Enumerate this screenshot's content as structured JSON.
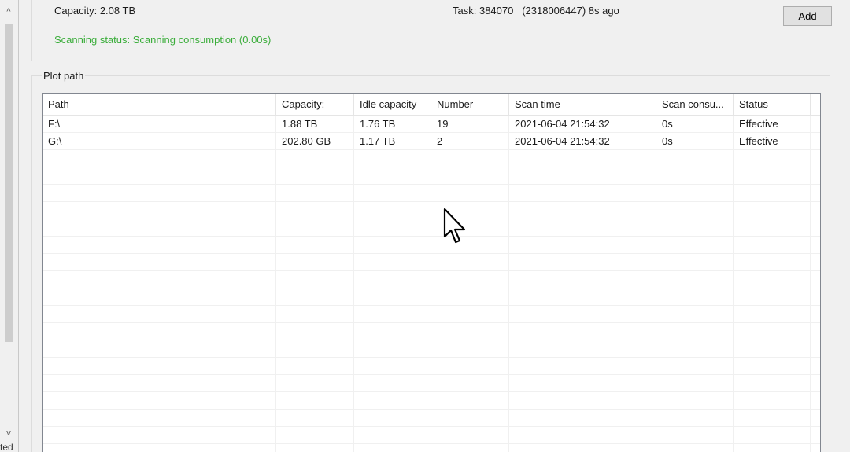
{
  "left_panel": {
    "scroll_up_glyph": "^",
    "scroll_down_glyph": "v",
    "clipped_text": "ted"
  },
  "info": {
    "capacity_label": "Capacity:",
    "capacity_value": "2.08 TB",
    "task_label": "Task:",
    "task_value": "384070",
    "task_detail": "(2318006447) 8s ago",
    "scan_status_label": "Scanning status:",
    "scan_status_value": "Scanning consumption (0.00s)"
  },
  "buttons": {
    "top_label": "",
    "add_label": "Add"
  },
  "plot_path": {
    "legend": "Plot path",
    "columns": [
      "Path",
      "Capacity:",
      "Idle capacity",
      "Number",
      "Scan time",
      "Scan consu...",
      "Status"
    ],
    "rows": [
      [
        "F:\\",
        "1.88 TB",
        "1.76 TB",
        "19",
        "2021-06-04 21:54:32",
        "0s",
        "Effective"
      ],
      [
        "G:\\",
        "202.80 GB",
        "1.17 TB",
        "2",
        "2021-06-04 21:54:32",
        "0s",
        "Effective"
      ],
      [
        "",
        "",
        "",
        "",
        "",
        "",
        ""
      ],
      [
        "",
        "",
        "",
        "",
        "",
        "",
        ""
      ],
      [
        "",
        "",
        "",
        "",
        "",
        "",
        ""
      ],
      [
        "",
        "",
        "",
        "",
        "",
        "",
        ""
      ],
      [
        "",
        "",
        "",
        "",
        "",
        "",
        ""
      ],
      [
        "",
        "",
        "",
        "",
        "",
        "",
        ""
      ],
      [
        "",
        "",
        "",
        "",
        "",
        "",
        ""
      ],
      [
        "",
        "",
        "",
        "",
        "",
        "",
        ""
      ],
      [
        "",
        "",
        "",
        "",
        "",
        "",
        ""
      ],
      [
        "",
        "",
        "",
        "",
        "",
        "",
        ""
      ],
      [
        "",
        "",
        "",
        "",
        "",
        "",
        ""
      ],
      [
        "",
        "",
        "",
        "",
        "",
        "",
        ""
      ],
      [
        "",
        "",
        "",
        "",
        "",
        "",
        ""
      ],
      [
        "",
        "",
        "",
        "",
        "",
        "",
        ""
      ],
      [
        "",
        "",
        "",
        "",
        "",
        "",
        ""
      ],
      [
        "",
        "",
        "",
        "",
        "",
        "",
        ""
      ],
      [
        "",
        "",
        "",
        "",
        "",
        "",
        ""
      ],
      [
        "",
        "",
        "",
        "",
        "",
        "",
        ""
      ]
    ]
  },
  "colors": {
    "status_green": "#3aad3a",
    "focus_blue": "#0078d7"
  }
}
